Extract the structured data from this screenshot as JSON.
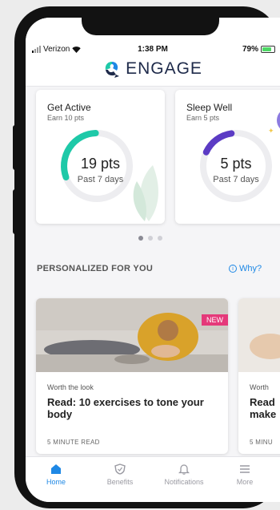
{
  "status": {
    "carrier": "Verizon",
    "time": "1:38 PM",
    "battery": "79%"
  },
  "app": {
    "name": "ENGAGE"
  },
  "activity_cards": [
    {
      "title": "Get Active",
      "subtitle": "Earn 10 pts",
      "value": "19 pts",
      "period": "Past 7 days",
      "color": "#1ec9a8"
    },
    {
      "title": "Sleep Well",
      "subtitle": "Earn 5 pts",
      "value": "5 pts",
      "period": "Past 7 days",
      "color": "#5b3bc4"
    }
  ],
  "section": {
    "title": "PERSONALIZED FOR YOU",
    "why_label": "Why?"
  },
  "articles": [
    {
      "badge": "NEW",
      "category": "Worth the look",
      "title": "Read: 10 exercises to tone your body",
      "read_time": "5 MINUTE READ"
    },
    {
      "category": "Worth",
      "title_line1": "Read",
      "title_line2": "make",
      "read_time": "5 MINU"
    }
  ],
  "tabs": [
    {
      "label": "Home",
      "icon": "home-icon",
      "active": true
    },
    {
      "label": "Benefits",
      "icon": "shield-icon"
    },
    {
      "label": "Notifications",
      "icon": "bell-icon"
    },
    {
      "label": "More",
      "icon": "menu-icon"
    }
  ]
}
